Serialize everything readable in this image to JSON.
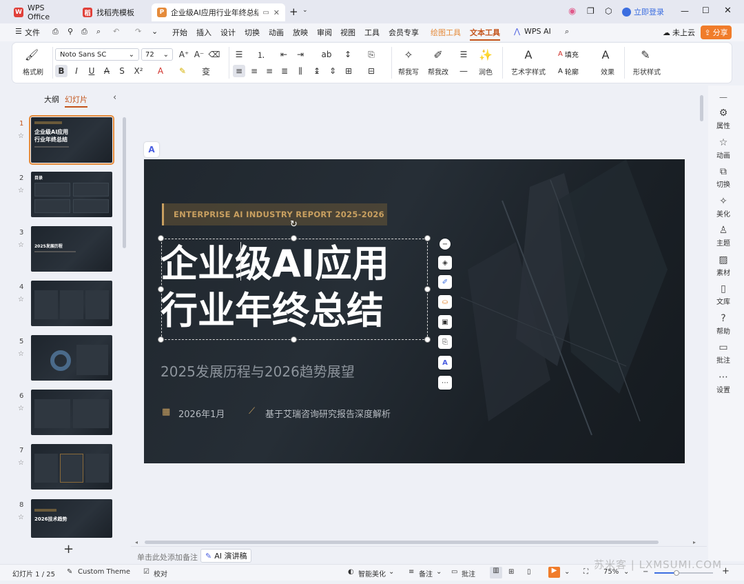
{
  "tabs": [
    {
      "label": "WPS Office"
    },
    {
      "label": "找稻壳模板"
    },
    {
      "label": "企业级AI应用行业年终总结.p"
    }
  ],
  "login": "立即登录",
  "menu": [
    "文件",
    "开始",
    "插入",
    "设计",
    "切换",
    "动画",
    "放映",
    "审阅",
    "视图",
    "工具",
    "会员专享",
    "绘图工具",
    "文本工具",
    "WPS AI"
  ],
  "cloud": "未上云",
  "share": "分享",
  "ribbon": {
    "format_brush": "格式刷",
    "font_name": "Noto Sans SC",
    "font_size": "72",
    "help_write": "帮我写",
    "help_edit": "帮我改",
    "polish": "润色",
    "art_style": "艺术字样式",
    "fill": "填充",
    "outline": "轮廓",
    "effect": "效果",
    "shape_style": "形状样式"
  },
  "leftpanel": {
    "outline_tab": "大纲",
    "slides_tab": "幻灯片",
    "add": "+"
  },
  "thumbs": [
    {
      "num": "1",
      "text": "企业级AI应用\n行业年终总结"
    },
    {
      "num": "2",
      "text": "目录"
    },
    {
      "num": "3",
      "text": "2025发展历程"
    },
    {
      "num": "4",
      "text": ""
    },
    {
      "num": "5",
      "text": ""
    },
    {
      "num": "6",
      "text": ""
    },
    {
      "num": "7",
      "text": ""
    },
    {
      "num": "8",
      "text": "2026技术趋势"
    }
  ],
  "slide": {
    "badge": "ENTERPRISE AI INDUSTRY REPORT 2025-2026",
    "title_line1": "企业级AI应用",
    "title_line2": "行业年终总结",
    "subtitle": "2025发展历程与2026趋势展望",
    "date": "2026年1月",
    "source": "基于艾瑞咨询研究报告深度解析"
  },
  "notes_placeholder": "单击此处添加备注",
  "ai_notes": "AI 演讲稿",
  "rightpanel": [
    "属性",
    "动画",
    "切换",
    "美化",
    "主题",
    "素材",
    "文库",
    "帮助",
    "批注",
    "设置"
  ],
  "status": {
    "slide_count": "幻灯片 1 / 25",
    "theme": "Custom Theme",
    "proof": "校对",
    "smart": "智能美化",
    "notes": "备注",
    "comments": "批注",
    "zoom": "75%"
  },
  "watermark": "苏米客 | LXMSUMI.COM",
  "colors": {
    "accent": "#e58b3b",
    "gold": "#c9a060",
    "wps_red": "#e0403a"
  }
}
